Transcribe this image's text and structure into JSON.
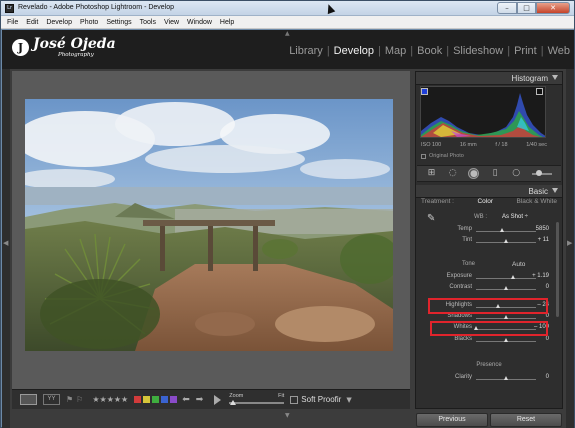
{
  "window": {
    "app_icon": "Lr",
    "title": "Revelado - Adobe Photoshop Lightroom - Develop",
    "min_label": "–",
    "max_label": "□",
    "close_label": "✕"
  },
  "menubar": {
    "items": [
      "File",
      "Edit",
      "Develop",
      "Photo",
      "Settings",
      "Tools",
      "View",
      "Window",
      "Help"
    ]
  },
  "identity_plate": {
    "mark": "J",
    "name": "José Ojeda",
    "subtitle": "Photography"
  },
  "modules": {
    "items": [
      "Library",
      "Develop",
      "Map",
      "Book",
      "Slideshow",
      "Print",
      "Web"
    ],
    "active": "Develop"
  },
  "histogram": {
    "title": "Histogram",
    "exif": [
      "ISO 100",
      "16 mm",
      "f / 18",
      "1/40 sec"
    ],
    "original_photo_label": "Original Photo"
  },
  "basic": {
    "title": "Basic",
    "tabs": [
      "Treatment :",
      "Color",
      "Black & White"
    ],
    "active_tab": "Color",
    "wb_label": "WB :",
    "wb_value": "As Shot ÷",
    "tone_label": "Tone",
    "auto_label": "Auto",
    "presence_label": "Presence",
    "sliders": [
      {
        "label": "Temp",
        "value": "5850",
        "position": 0.45
      },
      {
        "label": "Tint",
        "value": "+ 11",
        "position": 0.52
      },
      {
        "label": "Exposure",
        "value": "+ 1.19",
        "position": 0.62
      },
      {
        "label": "Contrast",
        "value": "0",
        "position": 0.5
      },
      {
        "label": "Highlights",
        "value": "– 24",
        "position": 0.38
      },
      {
        "label": "Shadows",
        "value": "0",
        "position": 0.5
      },
      {
        "label": "Whites",
        "value": "– 100",
        "position": 0.0
      },
      {
        "label": "Blacks",
        "value": "0",
        "position": 0.5
      },
      {
        "label": "Clarity",
        "value": "0",
        "position": 0.5
      }
    ]
  },
  "toolbar": {
    "stars": "★★★★★",
    "color_labels": [
      "#d23b3b",
      "#d6c63a",
      "#3fae3f",
      "#3a63d0",
      "#8a4bc9"
    ],
    "zoom_label": "Zoom",
    "zoom_fit": "Fit",
    "soft_proofing": "Soft Proofir"
  },
  "panel_buttons": {
    "previous": "Previous",
    "reset": "Reset"
  },
  "icons": {
    "view_loupe": "loupe-view-icon",
    "view_compare": "compare-view-icon",
    "crop": "crop-tool-icon",
    "spot": "spot-removal-icon",
    "redeye": "red-eye-icon",
    "gradient": "graduated-filter-icon",
    "radial": "radial-filter-icon",
    "brush": "adjustment-brush-icon"
  }
}
